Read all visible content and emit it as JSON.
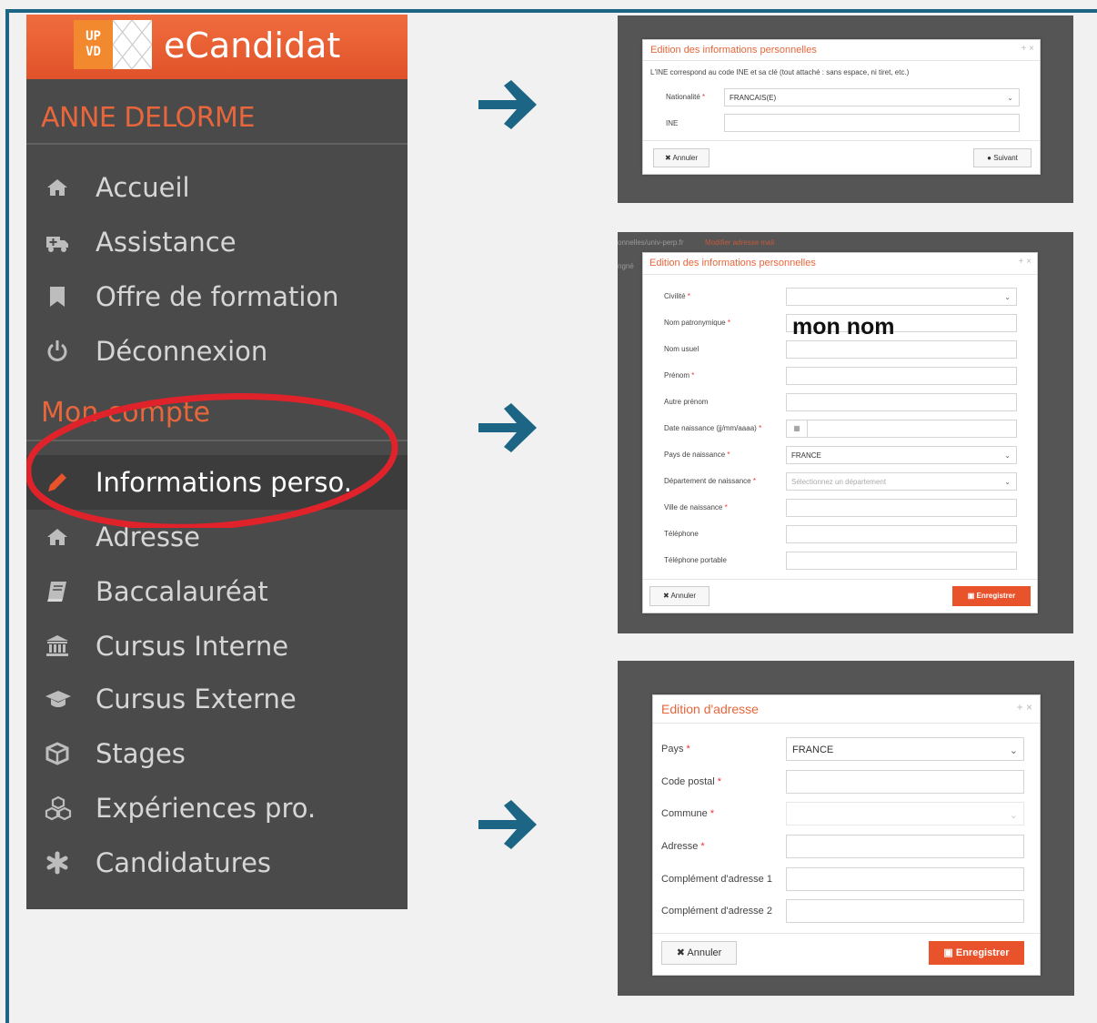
{
  "sidebar": {
    "logo_text_line1": "UP",
    "logo_text_line2": "VD",
    "app_name": "eCandidat",
    "user_name": "ANNE DELORME",
    "nav": [
      {
        "label": "Accueil",
        "icon": "home-icon"
      },
      {
        "label": "Assistance",
        "icon": "ambulance-icon"
      },
      {
        "label": "Offre de formation",
        "icon": "bookmark-icon"
      },
      {
        "label": "Déconnexion",
        "icon": "power-icon"
      }
    ],
    "section_title": "Mon compte",
    "account_nav": [
      {
        "label": "Informations perso.",
        "icon": "pencil-icon",
        "active": true
      },
      {
        "label": "Adresse",
        "icon": "home-icon"
      },
      {
        "label": "Baccalauréat",
        "icon": "book-icon"
      },
      {
        "label": "Cursus Interne",
        "icon": "institution-icon"
      },
      {
        "label": "Cursus Externe",
        "icon": "graduation-cap-icon"
      },
      {
        "label": "Stages",
        "icon": "cube-icon"
      },
      {
        "label": "Expériences pro.",
        "icon": "cubes-icon"
      },
      {
        "label": "Candidatures",
        "icon": "asterisk-icon"
      }
    ]
  },
  "colors": {
    "accent": "#e8663b",
    "arrow": "#1d6585",
    "highlight": "#e0232b",
    "sidebar_bg": "#4a4a4a"
  },
  "dialog1": {
    "title": "Edition des informations personnelles",
    "controls": "+ ×",
    "note": "L'INE correspond au code INE et sa clé (tout attaché : sans espace, ni tiret, etc.)",
    "nationalite_label": "Nationalité",
    "nationalite_value": "FRANCAIS(E)",
    "ine_label": "INE",
    "ine_value": "",
    "cancel": "Annuler",
    "next": "Suivant"
  },
  "dialog2": {
    "title": "Edition des informations personnelles",
    "controls": "+ ×",
    "bg_text1": "onnelles/univ-perp.fr",
    "bg_text2": "Modifier adresse mail",
    "bg_text3": "ngné",
    "fields": [
      {
        "label": "Civilité",
        "required": true,
        "value": "",
        "select": true
      },
      {
        "label": "Nom patronymique",
        "required": true,
        "value": "mon nom",
        "select": false
      },
      {
        "label": "Nom usuel",
        "required": false,
        "value": "",
        "select": false
      },
      {
        "label": "Prénom",
        "required": true,
        "value": "",
        "select": false
      },
      {
        "label": "Autre prénom",
        "required": false,
        "value": "",
        "select": false
      },
      {
        "label": "Date naissance (jj/mm/aaaa)",
        "required": true,
        "value": "",
        "select": false,
        "date": true
      },
      {
        "label": "Pays de naissance",
        "required": true,
        "value": "FRANCE",
        "select": true
      },
      {
        "label": "Département de naissance",
        "required": true,
        "value": "Sélectionnez un département",
        "select": true,
        "placeholder": true
      },
      {
        "label": "Ville de naissance",
        "required": true,
        "value": "",
        "select": false
      },
      {
        "label": "Téléphone",
        "required": false,
        "value": "",
        "select": false
      },
      {
        "label": "Téléphone portable",
        "required": false,
        "value": "",
        "select": false
      }
    ],
    "cancel": "Annuler",
    "save": "Enregistrer"
  },
  "dialog3": {
    "title": "Edition d'adresse",
    "controls": "+ ×",
    "fields": [
      {
        "label": "Pays",
        "required": true,
        "value": "FRANCE",
        "select": true
      },
      {
        "label": "Code postal",
        "required": true,
        "value": "",
        "select": false
      },
      {
        "label": "Commune",
        "required": true,
        "value": "",
        "select": true,
        "disabled": true
      },
      {
        "label": "Adresse",
        "required": true,
        "value": "",
        "select": false
      },
      {
        "label": "Complément d'adresse 1",
        "required": false,
        "value": "",
        "select": false
      },
      {
        "label": "Complément d'adresse 2",
        "required": false,
        "value": "",
        "select": false
      }
    ],
    "cancel": "Annuler",
    "save": "Enregistrer"
  }
}
